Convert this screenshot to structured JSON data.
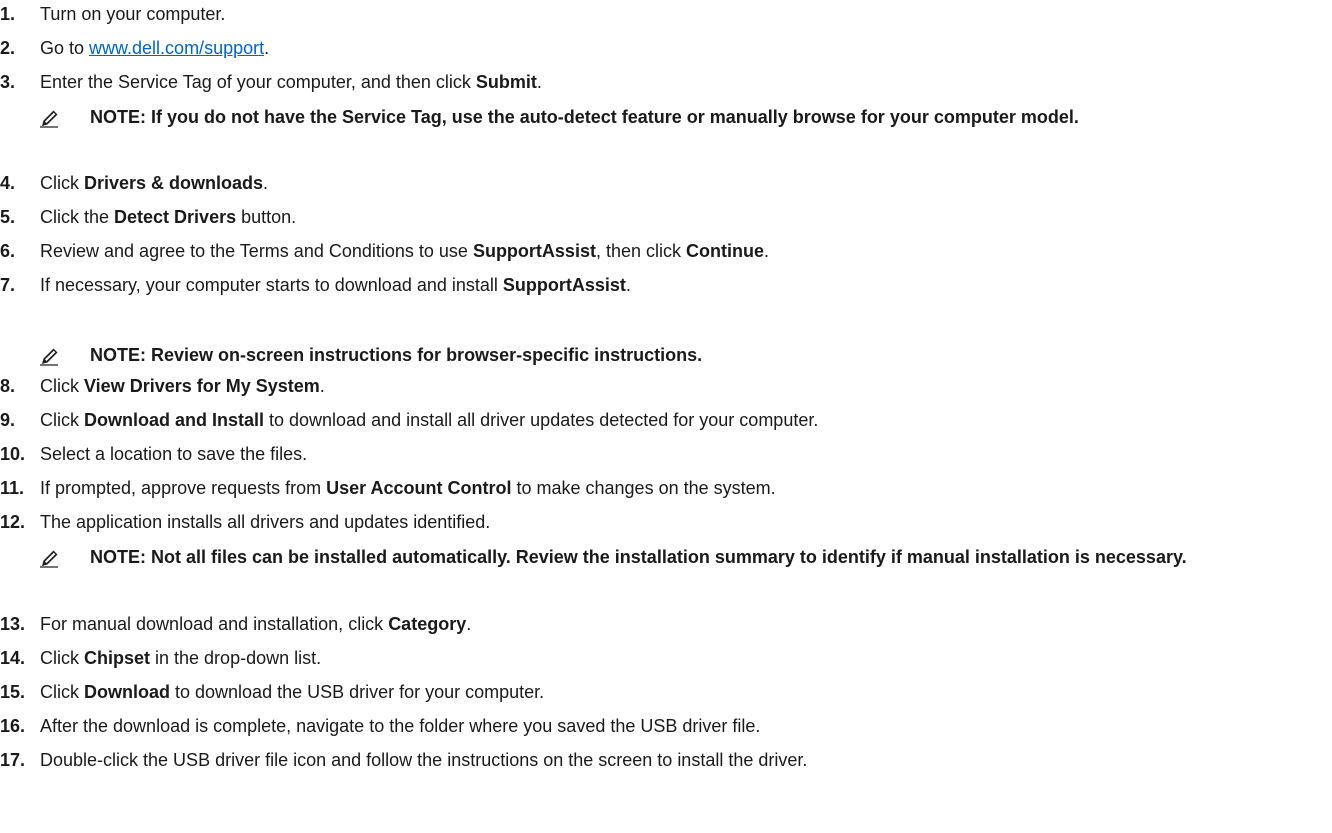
{
  "steps": [
    {
      "num": "1.",
      "parts": [
        {
          "t": "Turn on your computer."
        }
      ]
    },
    {
      "num": "2.",
      "parts": [
        {
          "t": "Go to "
        },
        {
          "t": "www.dell.com/support",
          "link": true
        },
        {
          "t": "."
        }
      ]
    },
    {
      "num": "3.",
      "parts": [
        {
          "t": "Enter the Service Tag of your computer, and then click "
        },
        {
          "t": "Submit",
          "b": true
        },
        {
          "t": "."
        }
      ]
    },
    {
      "num": "4.",
      "parts": [
        {
          "t": "Click "
        },
        {
          "t": "Drivers & downloads",
          "b": true
        },
        {
          "t": "."
        }
      ]
    },
    {
      "num": "5.",
      "parts": [
        {
          "t": "Click the "
        },
        {
          "t": "Detect Drivers",
          "b": true
        },
        {
          "t": " button."
        }
      ]
    },
    {
      "num": "6.",
      "parts": [
        {
          "t": "Review and agree to the Terms and Conditions to use "
        },
        {
          "t": "SupportAssist",
          "b": true
        },
        {
          "t": ", then click "
        },
        {
          "t": "Continue",
          "b": true
        },
        {
          "t": "."
        }
      ]
    },
    {
      "num": "7.",
      "parts": [
        {
          "t": "If necessary, your computer starts to download and install "
        },
        {
          "t": "SupportAssist",
          "b": true
        },
        {
          "t": "."
        }
      ]
    },
    {
      "num": "8.",
      "parts": [
        {
          "t": "Click "
        },
        {
          "t": "View Drivers for My System",
          "b": true
        },
        {
          "t": "."
        }
      ]
    },
    {
      "num": "9.",
      "parts": [
        {
          "t": "Click "
        },
        {
          "t": "Download and Install",
          "b": true
        },
        {
          "t": " to download and install all driver updates detected for your computer."
        }
      ]
    },
    {
      "num": "10.",
      "parts": [
        {
          "t": "Select a location to save the files."
        }
      ]
    },
    {
      "num": "11.",
      "parts": [
        {
          "t": "If prompted, approve requests from "
        },
        {
          "t": "User Account Control",
          "b": true
        },
        {
          "t": " to make changes on the system."
        }
      ]
    },
    {
      "num": "12.",
      "parts": [
        {
          "t": "The application installs all drivers and updates identified."
        }
      ]
    },
    {
      "num": "13.",
      "parts": [
        {
          "t": "For manual download and installation, click "
        },
        {
          "t": "Category",
          "b": true
        },
        {
          "t": "."
        }
      ]
    },
    {
      "num": "14.",
      "parts": [
        {
          "t": "Click "
        },
        {
          "t": "Chipset",
          "b": true
        },
        {
          "t": " in the drop-down list."
        }
      ]
    },
    {
      "num": "15.",
      "parts": [
        {
          "t": "Click "
        },
        {
          "t": "Download",
          "b": true
        },
        {
          "t": " to download the USB driver for your computer."
        }
      ]
    },
    {
      "num": "16.",
      "parts": [
        {
          "t": "After the download is complete, navigate to the folder where you saved the USB driver file."
        }
      ]
    },
    {
      "num": "17.",
      "parts": [
        {
          "t": "Double-click the USB driver file icon and follow the instructions on the screen to install the driver."
        }
      ]
    }
  ],
  "notes": [
    {
      "text": "NOTE: If you do not have the Service Tag, use the auto-detect feature or manually browse for your computer model."
    },
    {
      "text": "NOTE: Review on-screen instructions for browser-specific instructions."
    },
    {
      "text": "NOTE: Not all files can be installed automatically. Review the installation summary to identify if manual installation is necessary."
    }
  ],
  "colors": {
    "link": "#0563c1",
    "text": "#1a1a1a"
  },
  "icons": {
    "note": "note-pencil-icon"
  }
}
